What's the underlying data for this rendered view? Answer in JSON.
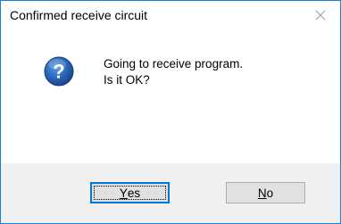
{
  "window": {
    "title": "Confirmed receive circuit",
    "close_icon": "close-icon"
  },
  "message": {
    "icon": "question-icon",
    "line1": "Going to receive program.",
    "line2": "Is it OK?"
  },
  "buttons": {
    "yes": {
      "mnemonic": "Y",
      "rest": "es"
    },
    "no": {
      "mnemonic": "N",
      "rest": "o"
    }
  },
  "colors": {
    "window_border": "#1883d7",
    "footer_background": "#f0f0f0",
    "button_face": "#e1e1e1",
    "default_button_border": "#0078d7",
    "question_icon": "#1e5aa8"
  }
}
